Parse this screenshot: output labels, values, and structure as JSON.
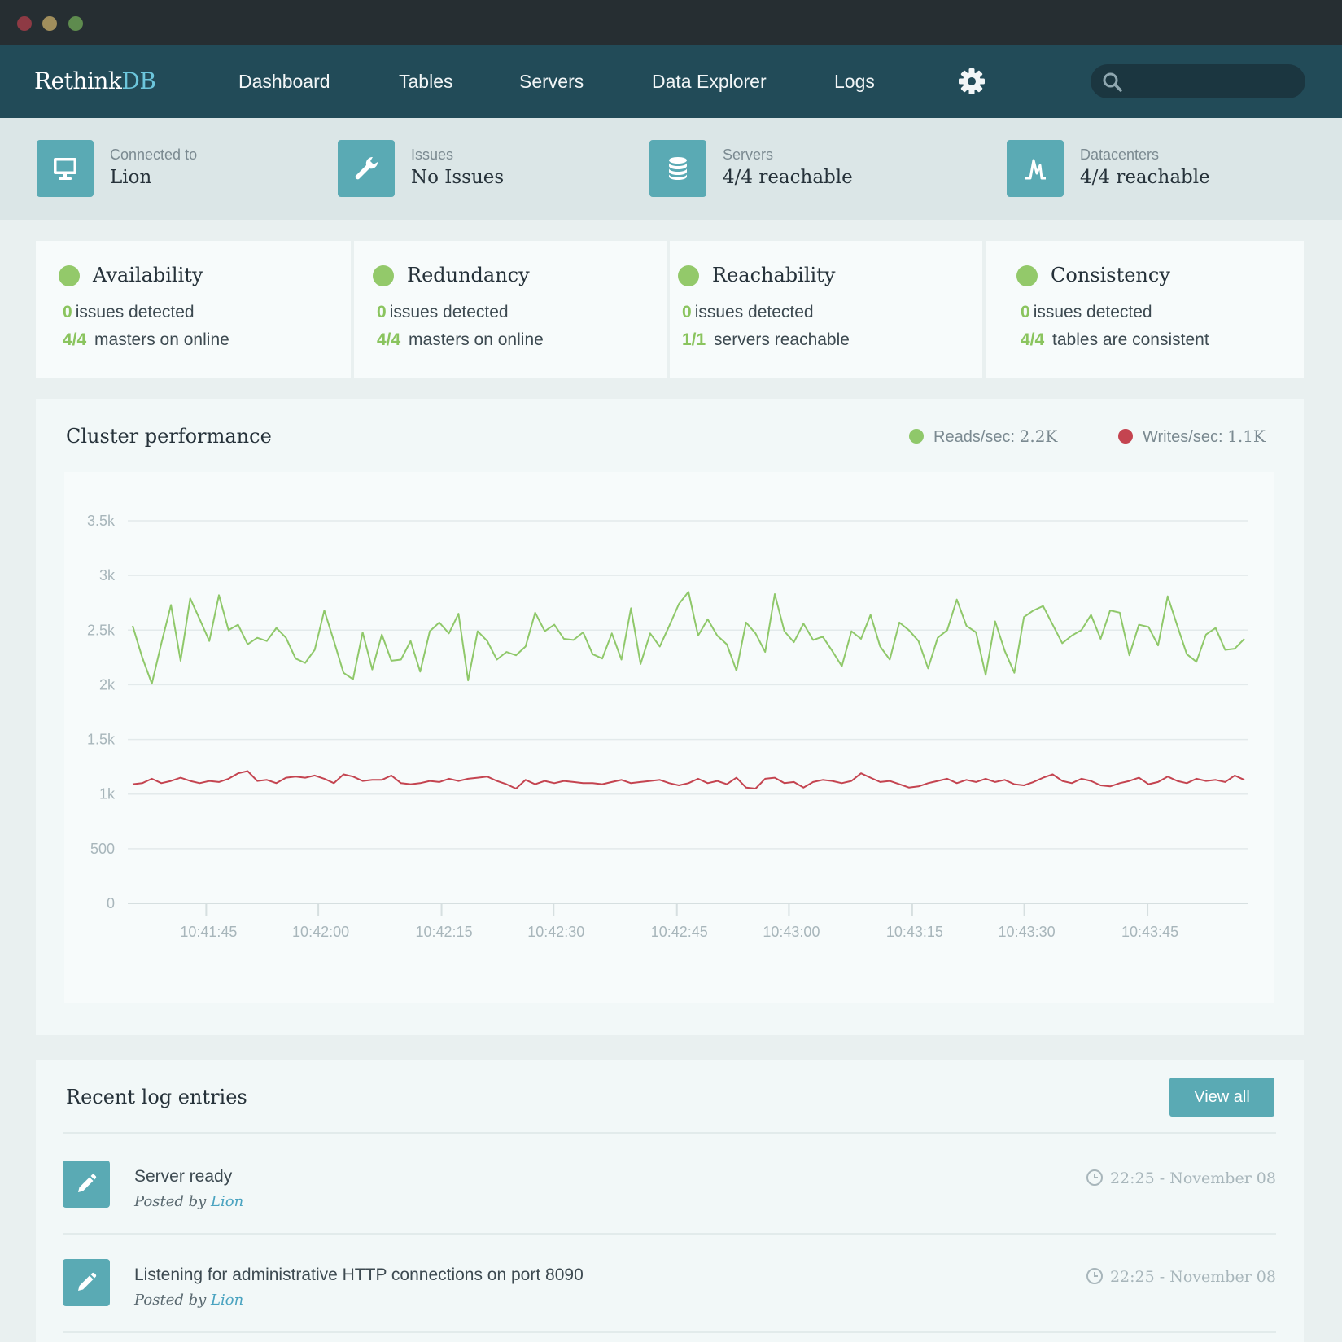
{
  "window": {
    "controls": [
      "close",
      "minimize",
      "maximize"
    ]
  },
  "nav": {
    "brand_main": "Rethink",
    "brand_accent": "DB",
    "items": [
      "Dashboard",
      "Tables",
      "Servers",
      "Data Explorer",
      "Logs"
    ],
    "settings_icon": "gear-icon",
    "search_icon": "search-icon",
    "search_value": ""
  },
  "status": [
    {
      "label": "Connected to",
      "value": "Lion",
      "icon": "monitor-icon"
    },
    {
      "label": "Issues",
      "value": "No Issues",
      "icon": "wrench-icon"
    },
    {
      "label": "Servers",
      "value": "4/4 reachable",
      "icon": "database-icon"
    },
    {
      "label": "Datacenters",
      "value": "4/4 reachable",
      "icon": "datacenter-icon"
    }
  ],
  "health": [
    {
      "title": "Availability",
      "issues_count": "0",
      "issues_text": "issues detected",
      "ratio": "4/4",
      "ratio_text": "masters on online"
    },
    {
      "title": "Redundancy",
      "issues_count": "0",
      "issues_text": "issues detected",
      "ratio": "4/4",
      "ratio_text": "masters on online"
    },
    {
      "title": "Reachability",
      "issues_count": "0",
      "issues_text": "issues detected",
      "ratio": "1/1",
      "ratio_text": "servers reachable"
    },
    {
      "title": "Consistency",
      "issues_count": "0",
      "issues_text": "issues detected",
      "ratio": "4/4",
      "ratio_text": "tables are consistent"
    }
  ],
  "performance": {
    "title": "Cluster performance",
    "reads_label": "Reads/sec:",
    "reads_value": "2.2K",
    "writes_label": "Writes/sec:",
    "writes_value": "1.1K"
  },
  "colors": {
    "reads": "#8fc86a",
    "writes": "#c44450",
    "accent": "#5aaab4",
    "navbar": "#224b58"
  },
  "chart_data": {
    "type": "line",
    "ylim": [
      0,
      3500
    ],
    "yticks": [
      0,
      500,
      1000,
      1500,
      2000,
      2500,
      3000,
      3500
    ],
    "ytick_labels": [
      "0",
      "500",
      "1k",
      "1.5k",
      "2k",
      "2.5k",
      "3k",
      "3.5k"
    ],
    "xlim": [
      0,
      100
    ],
    "xticks": [
      7,
      17,
      28,
      38,
      49,
      59,
      70,
      80,
      91
    ],
    "xtick_labels": [
      "10:41:45",
      "10:42:00",
      "10:42:15",
      "10:42:30",
      "10:42:45",
      "10:43:00",
      "10:43:15",
      "10:43:30",
      "10:43:45"
    ],
    "grid": true,
    "series": [
      {
        "name": "Reads/sec",
        "color": "#8fc86a",
        "values": [
          2540,
          2250,
          2010,
          2380,
          2730,
          2220,
          2790,
          2600,
          2400,
          2820,
          2500,
          2550,
          2370,
          2430,
          2400,
          2520,
          2430,
          2240,
          2200,
          2320,
          2680,
          2400,
          2110,
          2050,
          2480,
          2140,
          2460,
          2220,
          2230,
          2400,
          2120,
          2490,
          2570,
          2470,
          2650,
          2040,
          2490,
          2400,
          2230,
          2300,
          2270,
          2350,
          2660,
          2490,
          2550,
          2420,
          2410,
          2480,
          2280,
          2240,
          2470,
          2230,
          2700,
          2190,
          2470,
          2350,
          2540,
          2740,
          2850,
          2450,
          2600,
          2450,
          2370,
          2130,
          2570,
          2470,
          2300,
          2830,
          2490,
          2390,
          2560,
          2410,
          2440,
          2310,
          2170,
          2490,
          2420,
          2640,
          2350,
          2230,
          2570,
          2500,
          2400,
          2150,
          2430,
          2500,
          2780,
          2540,
          2480,
          2090,
          2580,
          2310,
          2110,
          2620,
          2680,
          2720,
          2550,
          2380,
          2450,
          2500,
          2640,
          2420,
          2680,
          2660,
          2270,
          2550,
          2530,
          2360,
          2810,
          2540,
          2280,
          2210,
          2460,
          2520,
          2320,
          2330,
          2420
        ]
      },
      {
        "name": "Writes/sec",
        "color": "#c44450",
        "values": [
          1090,
          1100,
          1140,
          1100,
          1120,
          1150,
          1120,
          1100,
          1120,
          1110,
          1140,
          1190,
          1210,
          1120,
          1130,
          1100,
          1150,
          1160,
          1150,
          1170,
          1140,
          1100,
          1180,
          1160,
          1120,
          1130,
          1130,
          1170,
          1100,
          1090,
          1100,
          1120,
          1110,
          1140,
          1120,
          1140,
          1150,
          1160,
          1120,
          1090,
          1050,
          1130,
          1090,
          1120,
          1100,
          1120,
          1110,
          1100,
          1100,
          1090,
          1110,
          1130,
          1100,
          1110,
          1120,
          1130,
          1100,
          1080,
          1100,
          1140,
          1100,
          1120,
          1090,
          1150,
          1060,
          1050,
          1140,
          1150,
          1100,
          1110,
          1060,
          1110,
          1130,
          1120,
          1100,
          1120,
          1190,
          1150,
          1110,
          1120,
          1090,
          1060,
          1070,
          1100,
          1120,
          1140,
          1100,
          1130,
          1110,
          1140,
          1110,
          1130,
          1090,
          1080,
          1110,
          1150,
          1180,
          1120,
          1100,
          1140,
          1120,
          1080,
          1070,
          1100,
          1120,
          1150,
          1090,
          1110,
          1160,
          1120,
          1100,
          1140,
          1120,
          1130,
          1110,
          1170,
          1130
        ]
      }
    ]
  },
  "logs": {
    "title": "Recent log entries",
    "view_all": "View all",
    "entries": [
      {
        "message": "Server ready",
        "posted_by": "Posted by",
        "author": "Lion",
        "time": "22:25 - November 08",
        "icon": "pencil-icon"
      },
      {
        "message": "Listening for administrative HTTP connections on port 8090",
        "posted_by": "Posted by",
        "author": "Lion",
        "time": "22:25 - November 08",
        "icon": "pencil-icon"
      }
    ]
  }
}
